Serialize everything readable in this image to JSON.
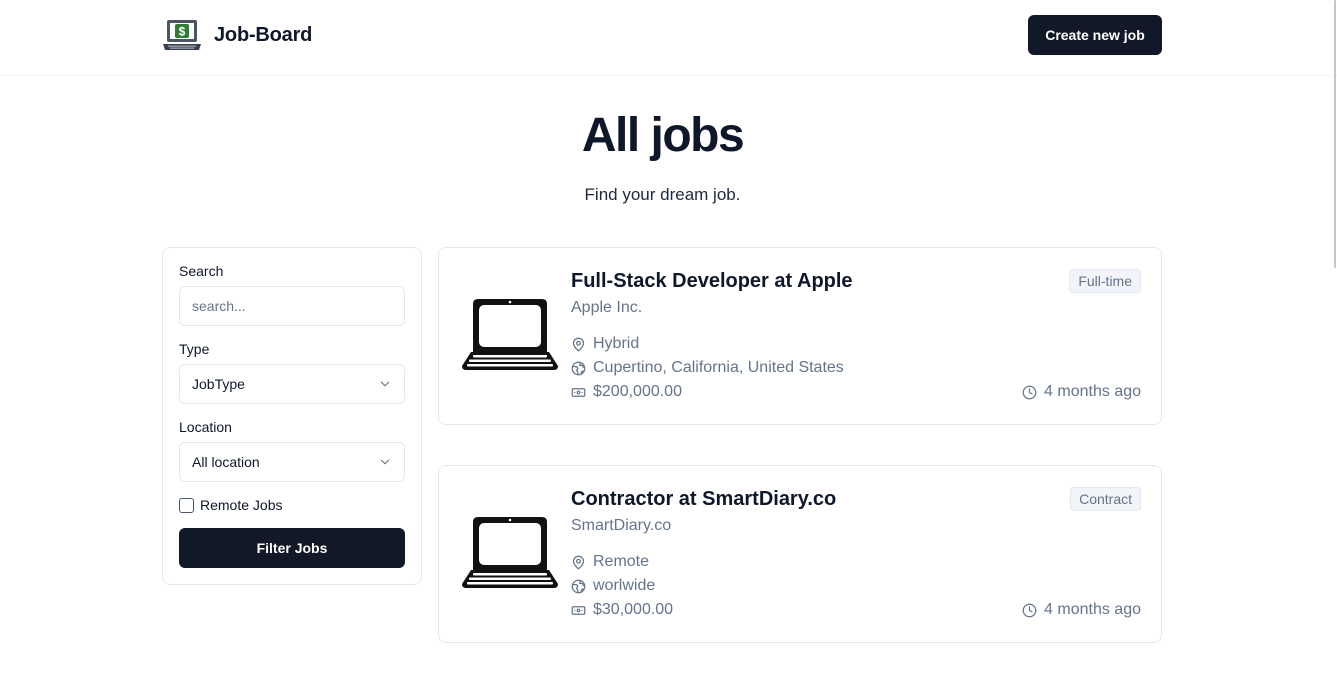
{
  "header": {
    "brand_name": "Job-Board",
    "create_button_label": "Create new job"
  },
  "hero": {
    "title": "All jobs",
    "subtitle": "Find your dream job."
  },
  "filters": {
    "search_label": "Search",
    "search_placeholder": "search...",
    "search_value": "",
    "type_label": "Type",
    "type_selected": "JobType",
    "location_label": "Location",
    "location_selected": "All location",
    "remote_label": "Remote Jobs",
    "remote_checked": false,
    "submit_label": "Filter Jobs"
  },
  "jobs": [
    {
      "title": "Full-Stack Developer at Apple",
      "company": "Apple Inc.",
      "location_type": "Hybrid",
      "location": "Cupertino, California, United States",
      "salary": "$200,000.00",
      "type": "Full-time",
      "posted": "4 months ago"
    },
    {
      "title": "Contractor at SmartDiary.co",
      "company": "SmartDiary.co",
      "location_type": "Remote",
      "location": "worlwide",
      "salary": "$30,000.00",
      "type": "Contract",
      "posted": "4 months ago"
    }
  ],
  "icons": {
    "brand": "laptop-dollar-icon",
    "job_logo": "laptop-icon",
    "location_type": "map-pin-icon",
    "location": "globe-icon",
    "salary": "banknote-icon",
    "posted": "clock-icon",
    "select": "chevron-down-icon"
  },
  "colors": {
    "primary": "#111827",
    "muted_text": "#64748b",
    "border": "#e5e7eb",
    "badge_bg": "#f1f5f9",
    "money_green": "#2e7d32"
  }
}
